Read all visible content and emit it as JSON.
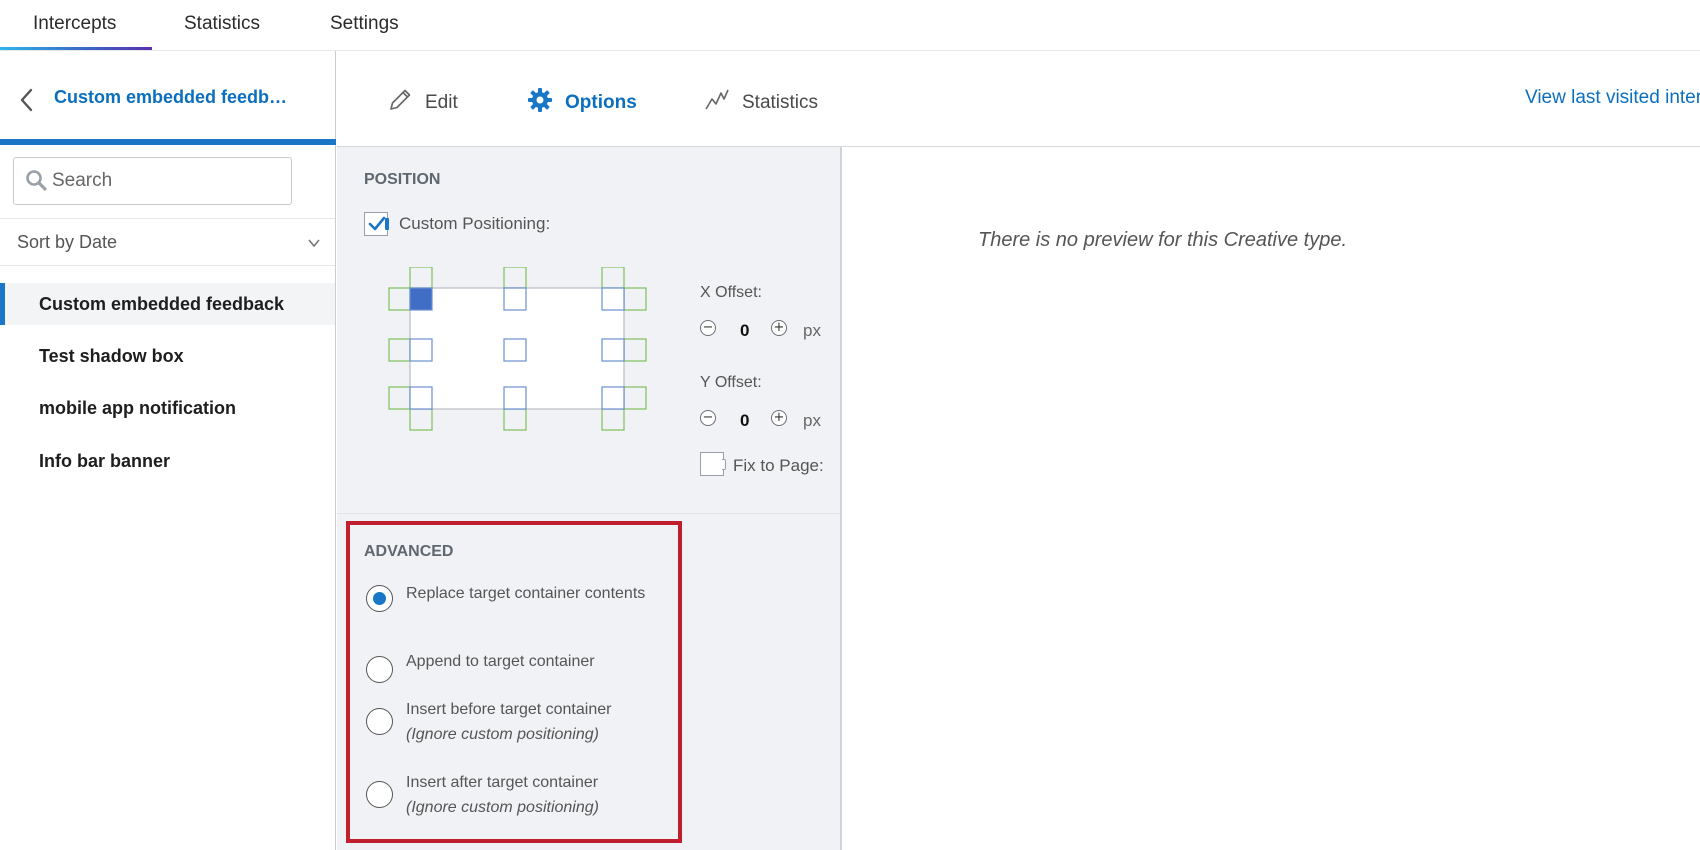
{
  "top_tabs": {
    "intercepts": "Intercepts",
    "statistics": "Statistics",
    "settings": "Settings"
  },
  "sidebar": {
    "title": "Custom embedded feedb…",
    "search_placeholder": "Search",
    "sort_label": "Sort by Date",
    "items": [
      {
        "label": "Custom embedded feedback",
        "active": true
      },
      {
        "label": "Test shadow box"
      },
      {
        "label": "mobile app notification"
      },
      {
        "label": "Info bar banner"
      }
    ]
  },
  "content_tabs": {
    "edit": "Edit",
    "options": "Options",
    "statistics": "Statistics",
    "view_link": "View last visited inter"
  },
  "position": {
    "title": "POSITION",
    "custom_positioning_label": "Custom Positioning:",
    "custom_positioning_checked": true,
    "x_offset_label": "X Offset:",
    "x_offset_value": "0",
    "y_offset_label": "Y Offset:",
    "y_offset_value": "0",
    "unit": "px",
    "minus": "−",
    "plus": "+",
    "fix_to_page_label": "Fix to Page:",
    "fix_to_page_checked": false
  },
  "advanced": {
    "title": "ADVANCED",
    "options": [
      {
        "label": "Replace target container contents",
        "note": "",
        "selected": true
      },
      {
        "label": "Append to target container",
        "note": "",
        "selected": false
      },
      {
        "label": "Insert before target container",
        "note": "(Ignore custom positioning)",
        "selected": false
      },
      {
        "label": "Insert after target container",
        "note": "(Ignore custom positioning)",
        "selected": false
      }
    ]
  },
  "preview": {
    "message": "There is no preview for this Creative type."
  },
  "colors": {
    "accent": "#1a76c6",
    "highlight_border": "#c0202e",
    "link": "#0b6fbf"
  },
  "icons": [
    "back-chevron-icon",
    "search-icon",
    "chevron-down-icon",
    "pencil-icon",
    "gear-icon",
    "trend-line-icon"
  ]
}
